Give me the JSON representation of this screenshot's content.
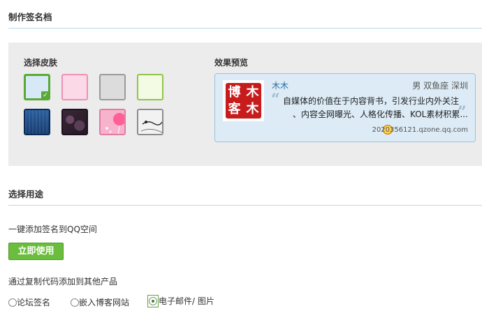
{
  "header": {
    "title": "制作签名档"
  },
  "skins": {
    "label": "选择皮肤",
    "items": [
      {
        "name": "light-blue",
        "color": "#d7e9f6",
        "border": "#59a937",
        "selected": true
      },
      {
        "name": "light-pink",
        "color": "#fbd9e6",
        "border": "#f08fb3",
        "selected": false
      },
      {
        "name": "light-gray",
        "color": "#dcdcdc",
        "border": "#9a9a9a",
        "selected": false
      },
      {
        "name": "light-green",
        "color": "#f3fbe4",
        "border": "#8fc44a",
        "selected": false
      },
      {
        "name": "dark-blue-texture",
        "color": "#1d4b86",
        "border": "#0c2c57",
        "selected": false
      },
      {
        "name": "dark-purple-texture",
        "color": "#3f2b3b",
        "border": "#1e1020",
        "selected": false
      },
      {
        "name": "pink-balloon",
        "color": "#f5a3c2",
        "border": "#e37ca4",
        "selected": false
      },
      {
        "name": "ink-painting",
        "color": "#efefef",
        "border": "#8c8c8c",
        "selected": false
      }
    ],
    "check_glyph": "✓"
  },
  "preview": {
    "label": "效果预览",
    "avatar_chars": [
      "木",
      "木",
      "博",
      "客"
    ],
    "name": "木木",
    "info": "男 双鱼座 深圳",
    "open_quote": "“",
    "close_quote": "”",
    "line1": "自媒体的价值在于内容背书，引发行业内外关注",
    "line2": "、内容全网曝光、人格化传播、KOL素材积累...",
    "url": "2020356121.qzone.qq.com"
  },
  "usage": {
    "title": "选择用途",
    "qq_text": "一键添加签名到QQ空间",
    "use_button": "立即使用",
    "copy_text": "通过复制代码添加到其他产品",
    "options": [
      {
        "label": "论坛签名",
        "checked": false
      },
      {
        "label": "嵌入博客网站",
        "checked": false
      },
      {
        "label": "电子邮件/ 图片",
        "checked": true
      }
    ]
  }
}
